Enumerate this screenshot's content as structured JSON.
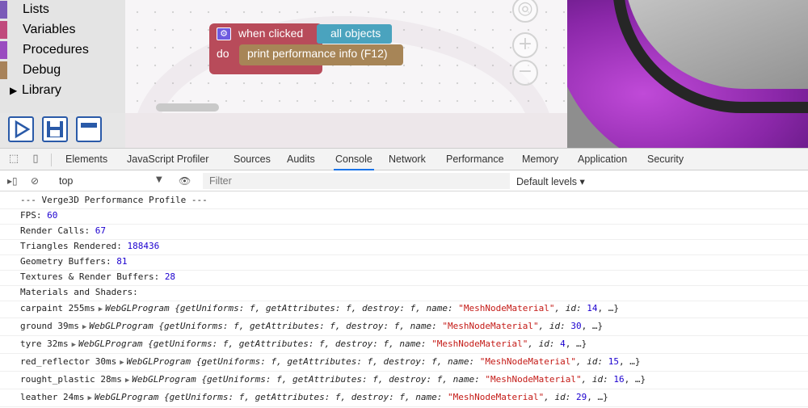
{
  "categories": [
    {
      "label": "Lists",
      "color": "#7a5ab8"
    },
    {
      "label": "Variables",
      "color": "#c04a7c"
    },
    {
      "label": "Procedures",
      "color": "#9a4cc0"
    },
    {
      "label": "Debug",
      "color": "#a7825a"
    },
    {
      "label": "Library",
      "color": null
    }
  ],
  "toolbar": {
    "run_icon": "play-icon",
    "save_icon": "floppy-icon",
    "minimize_icon": "minimize-icon"
  },
  "blocks": {
    "when_clicked": "when clicked",
    "all_objects": "all objects",
    "do": "do",
    "print_perf": "print performance info (F12)"
  },
  "devtools": {
    "tabs": [
      "Elements",
      "JavaScript Profiler",
      "Sources",
      "Audits",
      "Console",
      "Network",
      "Performance",
      "Memory",
      "Application",
      "Security"
    ],
    "active_tab": "Console",
    "context": "top",
    "filter_placeholder": "Filter",
    "levels": "Default levels ▾"
  },
  "console": {
    "header": "--- Verge3D Performance Profile ---",
    "stats": [
      {
        "label": "FPS: ",
        "value": "60"
      },
      {
        "label": "Render Calls: ",
        "value": "67"
      },
      {
        "label": "Triangles Rendered: ",
        "value": "188436"
      },
      {
        "label": "Geometry Buffers: ",
        "value": "81"
      },
      {
        "label": "Textures & Render Buffers: ",
        "value": "28"
      }
    ],
    "materials_header": "Materials and Shaders:",
    "materials": [
      {
        "name": "carpaint 255ms",
        "id": "14"
      },
      {
        "name": "ground 39ms",
        "id": "30"
      },
      {
        "name": "tyre 32ms",
        "id": "4"
      },
      {
        "name": "red_reflector 30ms",
        "id": "15"
      },
      {
        "name": "rought_plastic 28ms",
        "id": "16"
      },
      {
        "name": "leather 24ms",
        "id": "29"
      }
    ],
    "program_class": "WebGLProgram",
    "program_body_pre": " {getUniforms: f, getAttributes: f, destroy: f, name: ",
    "material_type": "\"MeshNodeMaterial\"",
    "id_prefix": ", id: ",
    "tail": ", …}"
  }
}
